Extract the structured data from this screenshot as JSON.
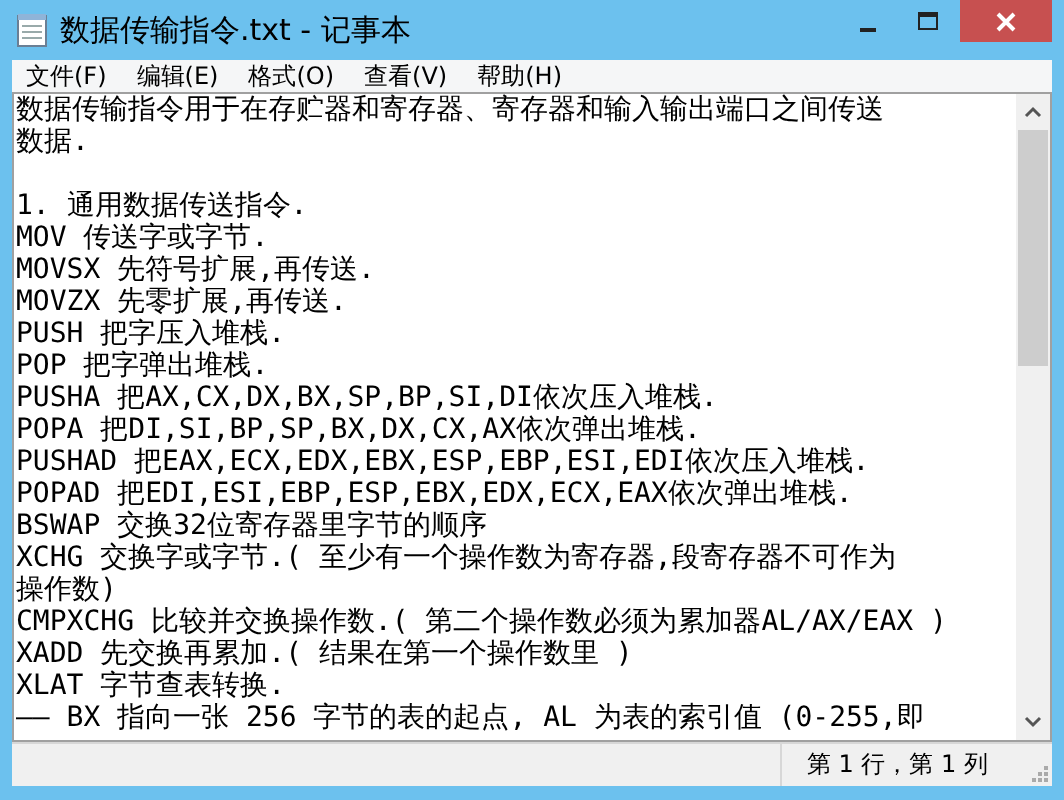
{
  "window": {
    "title": "数据传输指令.txt - 记事本"
  },
  "menu": [
    {
      "label": "文件(F)"
    },
    {
      "label": "编辑(E)"
    },
    {
      "label": "格式(O)"
    },
    {
      "label": "查看(V)"
    },
    {
      "label": "帮助(H)"
    }
  ],
  "text_blocks": [
    [
      "数据传输指令用于在存贮器和寄存器、寄存器和输入输出端口之间传送",
      "数据."
    ],
    [
      "1. 通用数据传送指令.",
      "MOV 传送字或字节.",
      "MOVSX 先符号扩展,再传送.",
      "MOVZX 先零扩展,再传送.",
      "PUSH 把字压入堆栈.",
      "POP 把字弹出堆栈.",
      "PUSHA 把AX,CX,DX,BX,SP,BP,SI,DI依次压入堆栈.",
      "POPA 把DI,SI,BP,SP,BX,DX,CX,AX依次弹出堆栈.",
      "PUSHAD 把EAX,ECX,EDX,EBX,ESP,EBP,ESI,EDI依次压入堆栈.",
      "POPAD 把EDI,ESI,EBP,ESP,EBX,EDX,ECX,EAX依次弹出堆栈.",
      "BSWAP 交换32位寄存器里字节的顺序",
      "XCHG 交换字或字节.( 至少有一个操作数为寄存器,段寄存器不可作为",
      "操作数)",
      "CMPXCHG 比较并交换操作数.( 第二个操作数必须为累加器AL/AX/EAX )",
      "XADD 先交换再累加.( 结果在第一个操作数里 )",
      "XLAT 字节查表转换.",
      "—— BX 指向一张 256 字节的表的起点, AL 为表的索引值 (0-255,即"
    ]
  ],
  "status_bar": {
    "position": "第 1 行，第 1 列"
  }
}
